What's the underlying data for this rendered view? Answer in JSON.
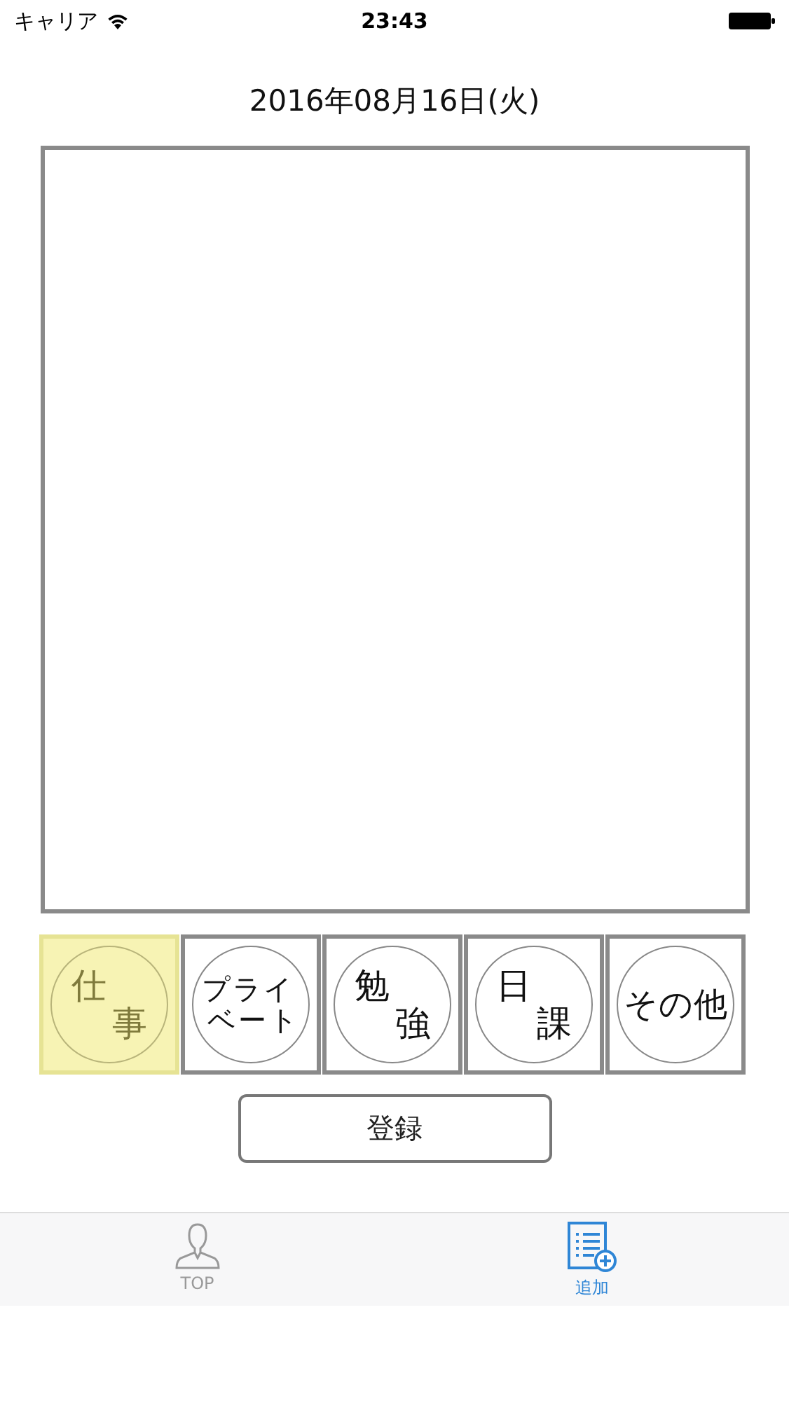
{
  "status_bar": {
    "carrier": "キャリア",
    "time": "23:43"
  },
  "date": "2016年08月16日(火)",
  "categories": [
    {
      "lines": [
        "仕",
        "事"
      ],
      "selected": true
    },
    {
      "lines": [
        "プライ",
        "ベート"
      ],
      "selected": false
    },
    {
      "lines": [
        "勉",
        "強"
      ],
      "selected": false
    },
    {
      "lines": [
        "日",
        "課"
      ],
      "selected": false
    },
    {
      "lines": [
        "その他"
      ],
      "selected": false
    }
  ],
  "register_button": "登録",
  "tab_bar": [
    {
      "kind": "person",
      "label": "TOP",
      "selected": false
    },
    {
      "kind": "add-list",
      "label": "追加",
      "selected": true
    }
  ]
}
